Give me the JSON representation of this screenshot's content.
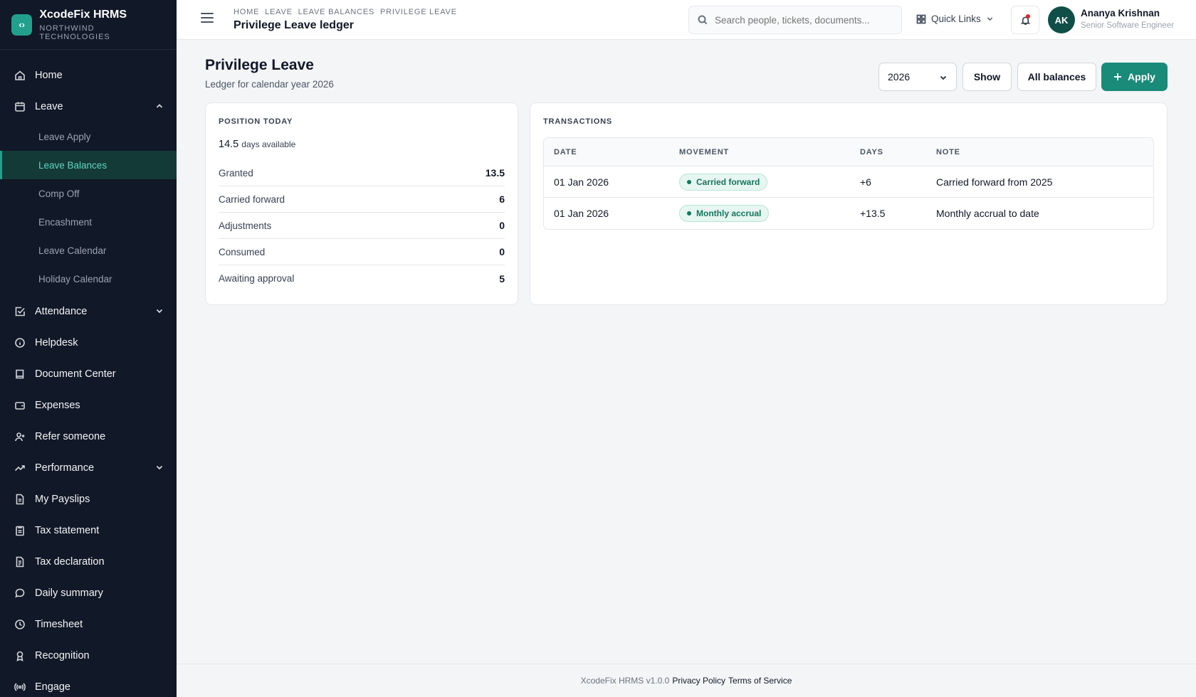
{
  "app": {
    "name": "XcodeFix HRMS",
    "org": "NORTHWIND TECHNOLOGIES",
    "logo_glyph": "‹›",
    "accent": "#1a8a79"
  },
  "sidebar": {
    "items": [
      {
        "label": "Home",
        "icon": "home-icon"
      },
      {
        "label": "Leave",
        "icon": "calendar-icon",
        "expanded": true,
        "children": [
          "Leave Apply",
          "Leave Balances",
          "Comp Off",
          "Encashment",
          "Leave Calendar",
          "Holiday Calendar"
        ],
        "active_child": "Leave Balances"
      },
      {
        "label": "Attendance",
        "icon": "check-square-icon",
        "expandable": true
      },
      {
        "label": "Helpdesk",
        "icon": "info-icon"
      },
      {
        "label": "Document Center",
        "icon": "book-icon"
      },
      {
        "label": "Expenses",
        "icon": "wallet-icon"
      },
      {
        "label": "Refer someone",
        "icon": "user-plus-icon"
      },
      {
        "label": "Performance",
        "icon": "trending-up-icon",
        "expandable": true
      },
      {
        "label": "My Payslips",
        "icon": "file-icon"
      },
      {
        "label": "Tax statement",
        "icon": "clipboard-icon"
      },
      {
        "label": "Tax declaration",
        "icon": "file-text-icon"
      },
      {
        "label": "Daily summary",
        "icon": "chat-icon"
      },
      {
        "label": "Timesheet",
        "icon": "clock-icon"
      },
      {
        "label": "Recognition",
        "icon": "award-icon"
      },
      {
        "label": "Engage",
        "icon": "broadcast-icon"
      }
    ]
  },
  "topbar": {
    "breadcrumbs": [
      "HOME",
      "LEAVE",
      "LEAVE BALANCES",
      "PRIVILEGE LEAVE"
    ],
    "title": "Privilege Leave ledger",
    "search_placeholder": "Search people, tickets, documents...",
    "quick_links": "Quick Links",
    "user": {
      "initials": "AK",
      "name": "Ananya Krishnan",
      "role": "Senior Software Engineer"
    }
  },
  "page": {
    "title": "Privilege Leave",
    "subtitle": "Ledger for calendar year 2026",
    "year": "2026",
    "show_label": "Show",
    "all_balances_label": "All balances",
    "apply_label": "Apply"
  },
  "position": {
    "label": "POSITION TODAY",
    "available_value": "14.5",
    "available_unit": "days available",
    "rows": [
      {
        "label": "Granted",
        "value": "13.5"
      },
      {
        "label": "Carried forward",
        "value": "6"
      },
      {
        "label": "Adjustments",
        "value": "0"
      },
      {
        "label": "Consumed",
        "value": "0"
      },
      {
        "label": "Awaiting approval",
        "value": "5"
      }
    ]
  },
  "transactions": {
    "label": "TRANSACTIONS",
    "columns": [
      "DATE",
      "MOVEMENT",
      "DAYS",
      "NOTE"
    ],
    "rows": [
      {
        "date": "01 Jan 2026",
        "movement": "Carried forward",
        "days": "+6",
        "note": "Carried forward from 2025"
      },
      {
        "date": "01 Jan 2026",
        "movement": "Monthly accrual",
        "days": "+13.5",
        "note": "Monthly accrual to date"
      }
    ]
  },
  "footer": {
    "version": "XcodeFix HRMS v1.0.0",
    "privacy": "Privacy Policy",
    "terms": "Terms of Service"
  }
}
